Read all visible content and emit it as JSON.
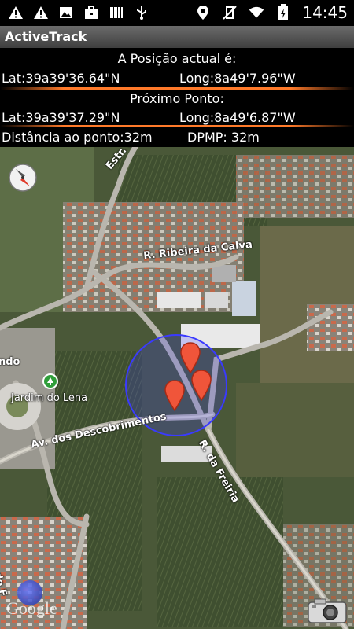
{
  "status_bar": {
    "time": "14:45",
    "icons_left": [
      "warning-icon",
      "warning-icon",
      "image-icon",
      "briefcase-icon",
      "barcode-icon",
      "usb-icon"
    ],
    "icons_right": [
      "location-pin-icon",
      "vibrate-off-icon",
      "wifi-icon",
      "battery-charging-icon"
    ]
  },
  "app": {
    "title": "ActiveTrack"
  },
  "info": {
    "current_heading": "A Posição actual é:",
    "current_lat": "Lat:39a39'36.64\"N",
    "current_long": "Long:8a49'7.96\"W",
    "next_heading": "Próximo Ponto:",
    "next_lat": "Lat:39a39'37.29\"N",
    "next_long": "Long:8a49'6.87\"W",
    "distance": "Distância ao ponto:32m",
    "dpmp": "DPMP: 32m"
  },
  "map": {
    "labels": {
      "estr_do": "Estr. do C",
      "ribeira": "R. Ribeira da Calva",
      "descobrimentos": "Av. dos Descobrimentos",
      "freiria": "R. da Freiria",
      "jardim": "Jardim do Lena",
      "ndo": "ndo",
      "r_de": "R. de F"
    },
    "google_logo": "Google",
    "circle_color": "#3a3aff",
    "marker_color": "#f0553a"
  }
}
